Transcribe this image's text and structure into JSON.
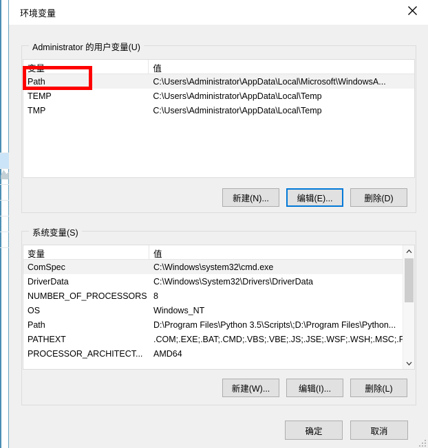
{
  "window": {
    "title": "环境变量",
    "close_icon": "close-icon"
  },
  "user_section": {
    "legend": "Administrator 的用户变量(U)",
    "columns": [
      "变量",
      "值"
    ],
    "rows": [
      {
        "name": "Path",
        "value": "C:\\Users\\Administrator\\AppData\\Local\\Microsoft\\WindowsA...",
        "selected": true
      },
      {
        "name": "TEMP",
        "value": "C:\\Users\\Administrator\\AppData\\Local\\Temp",
        "selected": false
      },
      {
        "name": "TMP",
        "value": "C:\\Users\\Administrator\\AppData\\Local\\Temp",
        "selected": false
      }
    ],
    "buttons": {
      "new": "新建(N)...",
      "edit": "编辑(E)...",
      "delete": "删除(D)"
    }
  },
  "system_section": {
    "legend": "系统变量(S)",
    "columns": [
      "变量",
      "值"
    ],
    "rows": [
      {
        "name": "ComSpec",
        "value": "C:\\Windows\\system32\\cmd.exe",
        "selected": true
      },
      {
        "name": "DriverData",
        "value": "C:\\Windows\\System32\\Drivers\\DriverData",
        "selected": false
      },
      {
        "name": "NUMBER_OF_PROCESSORS",
        "value": "8",
        "selected": false
      },
      {
        "name": "OS",
        "value": "Windows_NT",
        "selected": false
      },
      {
        "name": "Path",
        "value": "D:\\Program Files\\Python 3.5\\Scripts\\;D:\\Program Files\\Python...",
        "selected": false
      },
      {
        "name": "PATHEXT",
        "value": ".COM;.EXE;.BAT;.CMD;.VBS;.VBE;.JS;.JSE;.WSF;.WSH;.MSC;.PY;.P...",
        "selected": false
      },
      {
        "name": "PROCESSOR_ARCHITECT...",
        "value": "AMD64",
        "selected": false
      }
    ],
    "buttons": {
      "new": "新建(W)...",
      "edit": "编辑(I)...",
      "delete": "删除(L)"
    },
    "scrollbar": {
      "up_arrow": "chevron-up-icon",
      "down_arrow": "chevron-down-icon"
    }
  },
  "footer": {
    "ok": "确定",
    "cancel": "取消"
  },
  "annotation": {
    "color": "#ff0000",
    "target": "Path"
  }
}
